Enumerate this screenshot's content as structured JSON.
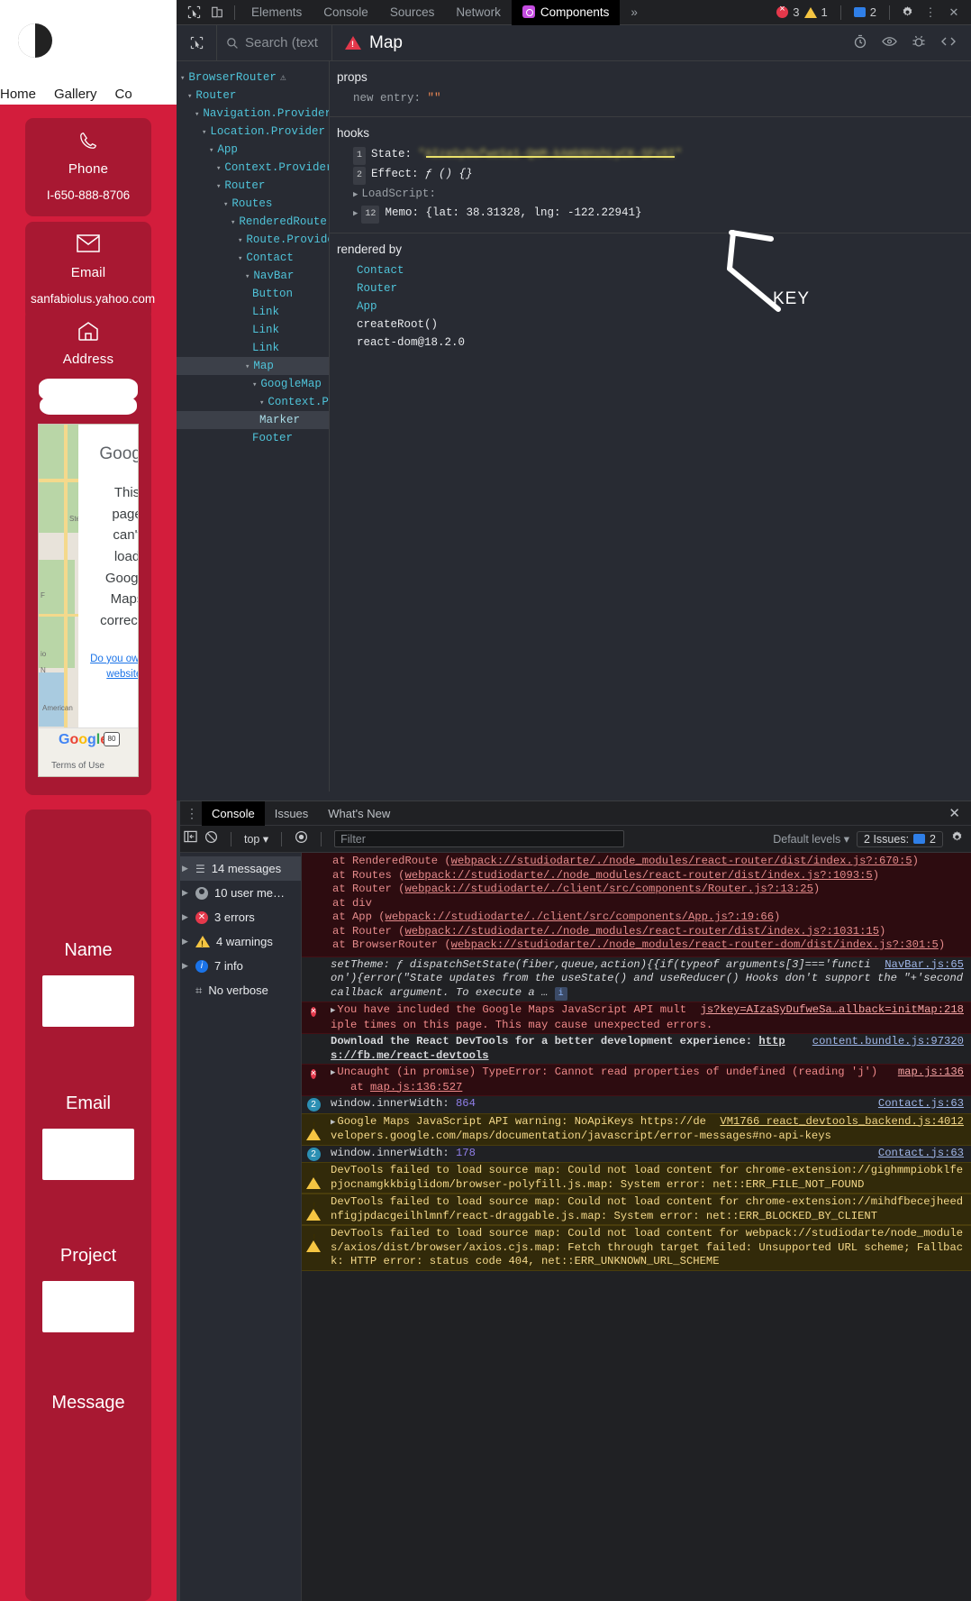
{
  "webpage": {
    "nav": [
      "Home",
      "Gallery",
      "Co"
    ],
    "cards": [
      {
        "icon": "phone-icon",
        "title": "Phone",
        "value": "I-650-888-8706"
      },
      {
        "icon": "email-icon",
        "title": "Email",
        "value": "sanfabiolus.yahoo.com"
      },
      {
        "icon": "home-icon",
        "title": "Address",
        "value": ""
      }
    ],
    "map_warning": {
      "brand": "Google",
      "lines": [
        "This",
        "page",
        "can't",
        "load",
        "Google",
        "Maps",
        "correctly."
      ],
      "link": "Do you own this website?",
      "footer_logo": "Google",
      "terms": "Terms of Use",
      "label_american": "American",
      "label_steelcan": "Steel Can",
      "shield": "80"
    },
    "form": {
      "fields": [
        {
          "label": "Name",
          "value": ""
        },
        {
          "label": "Email",
          "value": ""
        },
        {
          "label": "Project",
          "value": ""
        },
        {
          "label": "Message",
          "value": ""
        }
      ]
    }
  },
  "devtools": {
    "tabs": [
      "Elements",
      "Console",
      "Sources",
      "Network",
      "Components"
    ],
    "active_tab": "Components",
    "overflow": "»",
    "error_count": "3",
    "warning_count": "1",
    "message_count": "2",
    "icons": {
      "inspect": "inspect-element-icon",
      "device": "device-toolbar-icon",
      "settings": "gear-icon",
      "kebab": "more-options-icon",
      "close": "close-icon"
    }
  },
  "react_devtools": {
    "search_placeholder": "Search (text",
    "selected_component": "Map",
    "toolbar_icons": [
      "suspense-timer-icon",
      "eye-icon",
      "bug-icon",
      "view-source-icon"
    ],
    "tree": [
      {
        "label": "BrowserRouter",
        "depth": 0,
        "arrow": true,
        "warn": true
      },
      {
        "label": "Router",
        "depth": 1,
        "arrow": true
      },
      {
        "label": "Navigation.Provider",
        "depth": 2,
        "arrow": true
      },
      {
        "label": "Location.Provider",
        "depth": 3,
        "arrow": true
      },
      {
        "label": "App",
        "depth": 4,
        "arrow": true
      },
      {
        "label": "Context.Provider",
        "depth": 5,
        "arrow": true
      },
      {
        "label": "Router",
        "depth": 5,
        "arrow": true
      },
      {
        "label": "Routes",
        "depth": 6,
        "arrow": true
      },
      {
        "label": "RenderedRoute",
        "depth": 7,
        "arrow": true
      },
      {
        "label": "Route.Provider",
        "depth": 8,
        "arrow": true
      },
      {
        "label": "Contact",
        "depth": 8,
        "arrow": true
      },
      {
        "label": "NavBar",
        "depth": 9,
        "arrow": true
      },
      {
        "label": "Button",
        "depth": 10,
        "arrow": false
      },
      {
        "label": "Link",
        "depth": 10,
        "arrow": false
      },
      {
        "label": "Link",
        "depth": 10,
        "arrow": false
      },
      {
        "label": "Link",
        "depth": 10,
        "arrow": false
      },
      {
        "label": "Map",
        "depth": 9,
        "arrow": true,
        "selected": true
      },
      {
        "label": "GoogleMap",
        "depth": 10,
        "arrow": true
      },
      {
        "label": "Context.Provider",
        "depth": 11,
        "arrow": true
      },
      {
        "label": "Marker",
        "depth": 11,
        "arrow": false,
        "highlight": true
      },
      {
        "label": "Footer",
        "depth": 10,
        "arrow": false
      }
    ],
    "props": {
      "heading": "props",
      "entries": [
        {
          "key": "new entry",
          "value": "\"\""
        }
      ]
    },
    "hooks": {
      "heading": "hooks",
      "entries": [
        {
          "num": "1",
          "name": "State",
          "value": "\"AIzaSyDufweSa1-QmM-kAmbNHshLyCK-SFv8I\"",
          "redacted": true
        },
        {
          "num": "2",
          "name": "Effect",
          "value": "ƒ () {}"
        },
        {
          "num": "",
          "name": "LoadScript",
          "value": "",
          "collapsed": true
        },
        {
          "num": "12",
          "name": "Memo",
          "value": "{lat: 38.31328, lng: -122.22941}",
          "collapsed": true
        }
      ]
    },
    "rendered_by": {
      "heading": "rendered by",
      "items": [
        "Contact",
        "Router",
        "App",
        "createRoot()",
        "react-dom@18.2.0"
      ]
    },
    "annotation": "KEY"
  },
  "console": {
    "tabs": [
      "Console",
      "Issues",
      "What's New"
    ],
    "active_tab": "Console",
    "context": "top",
    "filter_placeholder": "Filter",
    "levels": "Default levels",
    "issues_label": "2 Issues:",
    "issues_count": "2",
    "sidebar": [
      {
        "label": "14 messages",
        "icon": "list-icon",
        "selected": true
      },
      {
        "label": "10 user me…",
        "icon": "user-icon"
      },
      {
        "label": "3 errors",
        "icon": "error-icon"
      },
      {
        "label": "4 warnings",
        "icon": "warning-icon"
      },
      {
        "label": "7 info",
        "icon": "info-icon"
      },
      {
        "label": "No verbose",
        "icon": "verbose-icon"
      }
    ],
    "stack_lines": [
      {
        "fn": "at RenderedRoute (",
        "url": "webpack://studiodarte/./node_modules/react-router/dist/index.js?:670:5",
        "close": ")"
      },
      {
        "fn": "at Routes (",
        "url": "webpack://studiodarte/./node_modules/react-router/dist/index.js?:1093:5",
        "close": ")"
      },
      {
        "fn": "at Router (",
        "url": "webpack://studiodarte/./client/src/components/Router.js?:13:25",
        "close": ")"
      },
      {
        "fn": "at div",
        "url": "",
        "close": ""
      },
      {
        "fn": "at App (",
        "url": "webpack://studiodarte/./client/src/components/App.js?:19:66",
        "close": ")"
      },
      {
        "fn": "at Router (",
        "url": "webpack://studiodarte/./node_modules/react-router/dist/index.js?:1031:15",
        "close": ")"
      },
      {
        "fn": "at BrowserRouter (",
        "url": "webpack://studiodarte/./node_modules/react-router-dom/dist/index.js?:301:5",
        "close": ")"
      }
    ],
    "messages": [
      {
        "type": "plain-italic",
        "text": "setTheme: ƒ dispatchSetState(fiber,queue,action){{if(typeof arguments[3]==='function'){error(\"State updates from the useState() and useReducer() Hooks don't support the \"+'second callback argument. To execute a … ",
        "src": "NavBar.js:65",
        "badge": "i"
      },
      {
        "type": "error",
        "text": "You have included the Google Maps JavaScript API multiple times on this page. This may cause unexpected errors.",
        "src": "js?key=AIzaSyDufweSa…allback=initMap:218"
      },
      {
        "type": "plain-bold",
        "text": "Download the React DevTools for a better development experience: https://fb.me/react-devtools",
        "src": "content.bundle.js:97320"
      },
      {
        "type": "error",
        "text": "Uncaught (in promise) TypeError: Cannot read properties of undefined (reading 'j')",
        "sub": "at map.js:136:527",
        "src": "map.js:136"
      },
      {
        "type": "info-count",
        "count": "2",
        "text": "window.innerWidth:",
        "value": "864",
        "src": "Contact.js:63"
      },
      {
        "type": "warning",
        "text": "Google Maps JavaScript API warning: NoApiKeys https://developers.google.com/maps/documentation/javascript/error-messages#no-api-keys",
        "src": "VM1766 react_devtools_backend.js:4012"
      },
      {
        "type": "info-count",
        "count": "2",
        "text": "window.innerWidth:",
        "value": "178",
        "src": "Contact.js:63"
      },
      {
        "type": "warning",
        "text": "DevTools failed to load source map: Could not load content for chrome-extension://gighmmpiobklfepjocnamgkkbiglidom/browser-polyfill.js.map: System error: net::ERR_FILE_NOT_FOUND",
        "src": ""
      },
      {
        "type": "warning",
        "text": "DevTools failed to load source map: Could not load content for chrome-extension://mihdfbecejheednfigjpdacgeilhlmnf/react-draggable.js.map: System error: net::ERR_BLOCKED_BY_CLIENT",
        "src": ""
      },
      {
        "type": "warning",
        "text": "DevTools failed to load source map: Could not load content for webpack://studiodarte/node_modules/axios/dist/browser/axios.cjs.map: Fetch through target failed: Unsupported URL scheme; Fallback: HTTP error: status code 404, net::ERR_UNKNOWN_URL_SCHEME",
        "src": ""
      }
    ]
  }
}
